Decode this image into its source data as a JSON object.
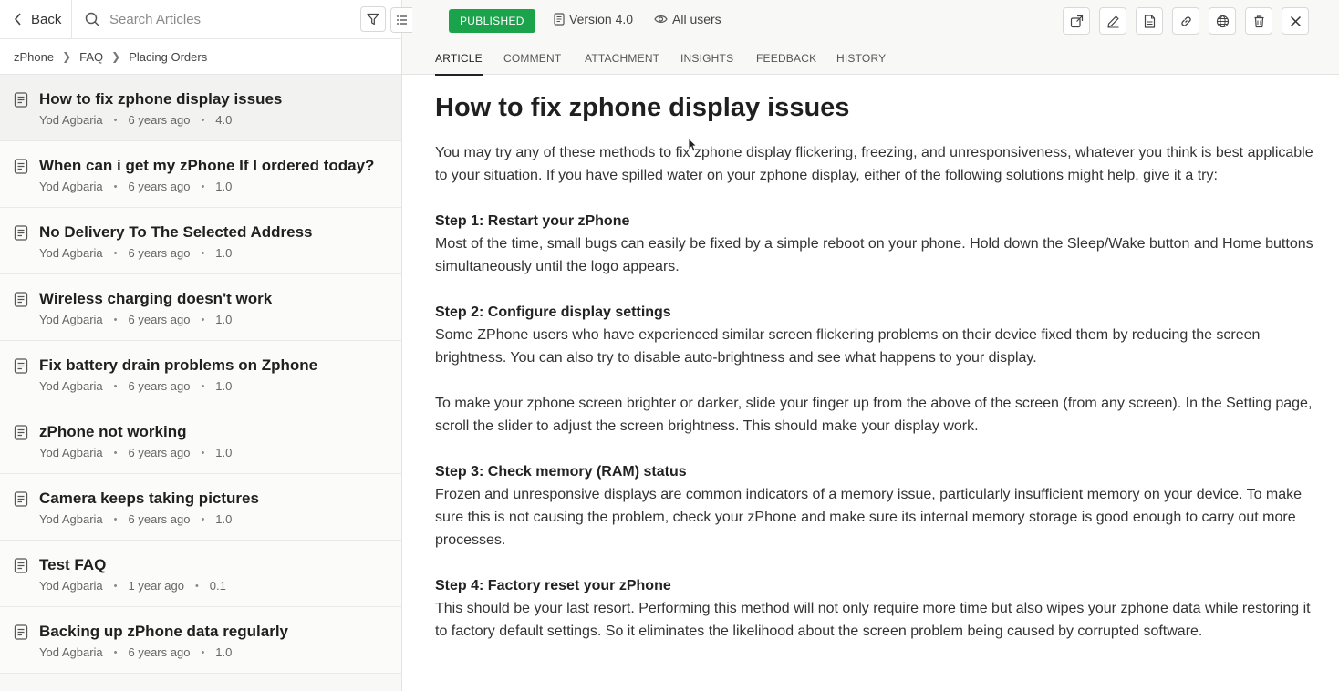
{
  "left": {
    "back_label": "Back",
    "search_placeholder": "Search Articles",
    "breadcrumb": [
      "zPhone",
      "FAQ",
      "Placing Orders"
    ],
    "articles": [
      {
        "title": "How to fix zphone display issues",
        "author": "Yod Agbaria",
        "time": "6 years ago",
        "version": "4.0"
      },
      {
        "title": "When can i get my zPhone If I ordered today?",
        "author": "Yod Agbaria",
        "time": "6 years ago",
        "version": "1.0"
      },
      {
        "title": "No Delivery To The Selected Address",
        "author": "Yod Agbaria",
        "time": "6 years ago",
        "version": "1.0"
      },
      {
        "title": "Wireless charging doesn't work",
        "author": "Yod Agbaria",
        "time": "6 years ago",
        "version": "1.0"
      },
      {
        "title": "Fix battery drain problems on Zphone",
        "author": "Yod Agbaria",
        "time": "6 years ago",
        "version": "1.0"
      },
      {
        "title": "zPhone not working",
        "author": "Yod Agbaria",
        "time": "6 years ago",
        "version": "1.0"
      },
      {
        "title": "Camera keeps taking pictures",
        "author": "Yod Agbaria",
        "time": "6 years ago",
        "version": "1.0"
      },
      {
        "title": "Test FAQ",
        "author": "Yod Agbaria",
        "time": "1 year ago",
        "version": "0.1"
      },
      {
        "title": "Backing up zPhone data regularly",
        "author": "Yod Agbaria",
        "time": "6 years ago",
        "version": "1.0"
      }
    ]
  },
  "header": {
    "status": "PUBLISHED",
    "version": "Version 4.0",
    "audience": "All users",
    "status_color": "#1ba34b"
  },
  "tabs": [
    "ARTICLE",
    "COMMENT",
    "ATTACHMENT",
    "INSIGHTS",
    "FEEDBACK",
    "HISTORY"
  ],
  "article": {
    "title": "How to fix zphone display issues",
    "intro": "You may try any of these methods to fix zphone display flickering, freezing, and unresponsiveness, whatever you think is best applicable to your situation. If you have spilled water on your zphone display, either of the following solutions might help, give it a try:",
    "steps": [
      {
        "heading": "Step 1: Restart your zPhone",
        "body": "Most of the time, small bugs can easily be fixed by a simple reboot on your phone. Hold down the Sleep/Wake button and Home buttons simultaneously until the logo appears."
      },
      {
        "heading": "Step 2: Configure display settings",
        "body": "Some ZPhone users who have experienced similar screen flickering problems on their device fixed them by reducing the screen brightness.  You can also try to disable auto-brightness and see what happens to your display.",
        "extra": "To make your zphone screen brighter or darker, slide your finger up from the above of the screen (from any screen). In the Setting page, scroll the slider to adjust the screen brightness. This should make your display work."
      },
      {
        "heading": "Step 3: Check memory (RAM) status",
        "body": "Frozen and unresponsive displays are common indicators of a memory issue, particularly insufficient memory on your device. To make sure this is not causing the problem, check your zPhone and make sure its internal memory storage is good enough to carry out more processes."
      },
      {
        "heading": "Step 4: Factory reset your zPhone",
        "body": "This should be your last resort. Performing this method will not only require more time but also wipes your zphone data while restoring it to factory default settings. So it eliminates the likelihood about the screen problem being caused by corrupted software."
      }
    ]
  },
  "toolbar_icons": [
    "share-icon",
    "edit-icon",
    "pdf-icon",
    "link-icon",
    "translate-icon",
    "delete-icon",
    "close-icon"
  ]
}
